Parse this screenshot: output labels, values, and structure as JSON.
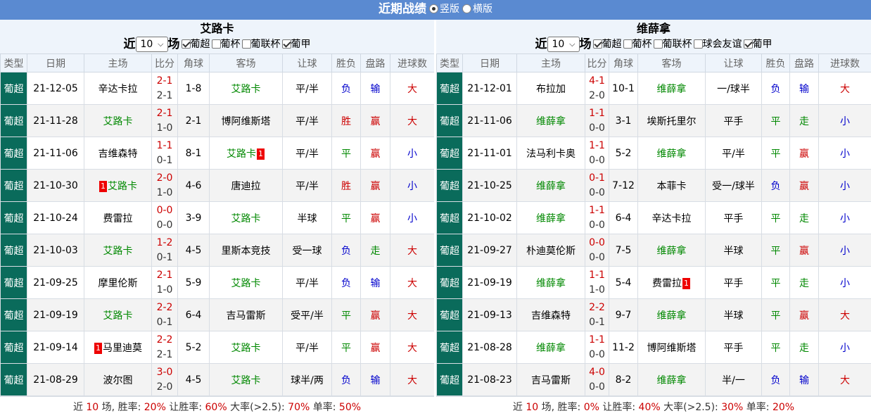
{
  "header": {
    "title": "近期战绩",
    "view_vertical": "竖版",
    "view_horizontal": "横版"
  },
  "columns": [
    "类型",
    "日期",
    "主场",
    "比分",
    "角球",
    "客场",
    "让球",
    "胜负",
    "盘路",
    "进球数"
  ],
  "left": {
    "team": "艾路卡",
    "recent_prefix": "近",
    "recent_count": "10",
    "recent_suffix": "场",
    "filters": [
      {
        "label": "葡超",
        "checked": true
      },
      {
        "label": "葡杯",
        "checked": false
      },
      {
        "label": "葡联杯",
        "checked": false
      },
      {
        "label": "葡甲",
        "checked": true
      }
    ],
    "rows": [
      {
        "type": "葡超",
        "date": "21-12-05",
        "home": "辛达卡拉",
        "home_hl": false,
        "home_rc": "",
        "ft": "2-1",
        "ht": "2-1",
        "corner": "1-8",
        "away": "艾路卡",
        "away_hl": true,
        "away_rc": "",
        "handicap": "平/半",
        "result": "负",
        "result_c": "blue",
        "pan": "输",
        "pan_c": "blue",
        "goals": "大",
        "goals_c": "red"
      },
      {
        "type": "葡超",
        "date": "21-11-28",
        "home": "艾路卡",
        "home_hl": true,
        "home_rc": "",
        "ft": "2-1",
        "ht": "1-0",
        "corner": "2-1",
        "away": "博阿维斯塔",
        "away_hl": false,
        "away_rc": "",
        "handicap": "平/半",
        "result": "胜",
        "result_c": "red",
        "pan": "赢",
        "pan_c": "red",
        "goals": "大",
        "goals_c": "red"
      },
      {
        "type": "葡超",
        "date": "21-11-06",
        "home": "吉维森特",
        "home_hl": false,
        "home_rc": "",
        "ft": "1-1",
        "ht": "0-1",
        "corner": "8-1",
        "away": "艾路卡",
        "away_hl": true,
        "away_rc": "1",
        "handicap": "平/半",
        "result": "平",
        "result_c": "green",
        "pan": "赢",
        "pan_c": "red",
        "goals": "小",
        "goals_c": "blue"
      },
      {
        "type": "葡超",
        "date": "21-10-30",
        "home": "艾路卡",
        "home_hl": true,
        "home_rc_pre": "1",
        "home_rc": "",
        "ft": "2-0",
        "ht": "1-0",
        "corner": "4-6",
        "away": "唐迪拉",
        "away_hl": false,
        "away_rc": "",
        "handicap": "平/半",
        "result": "胜",
        "result_c": "red",
        "pan": "赢",
        "pan_c": "red",
        "goals": "小",
        "goals_c": "blue"
      },
      {
        "type": "葡超",
        "date": "21-10-24",
        "home": "费雷拉",
        "home_hl": false,
        "home_rc": "",
        "ft": "0-0",
        "ht": "0-0",
        "corner": "3-9",
        "away": "艾路卡",
        "away_hl": true,
        "away_rc": "",
        "handicap": "半球",
        "result": "平",
        "result_c": "green",
        "pan": "赢",
        "pan_c": "red",
        "goals": "小",
        "goals_c": "blue"
      },
      {
        "type": "葡超",
        "date": "21-10-03",
        "home": "艾路卡",
        "home_hl": true,
        "home_rc": "",
        "ft": "1-2",
        "ht": "0-1",
        "corner": "4-5",
        "away": "里斯本竞技",
        "away_hl": false,
        "away_rc": "",
        "handicap": "受一球",
        "result": "负",
        "result_c": "blue",
        "pan": "走",
        "pan_c": "green",
        "goals": "大",
        "goals_c": "red"
      },
      {
        "type": "葡超",
        "date": "21-09-25",
        "home": "摩里伦斯",
        "home_hl": false,
        "home_rc": "",
        "ft": "2-1",
        "ht": "1-0",
        "corner": "5-9",
        "away": "艾路卡",
        "away_hl": true,
        "away_rc": "",
        "handicap": "平/半",
        "result": "负",
        "result_c": "blue",
        "pan": "输",
        "pan_c": "blue",
        "goals": "大",
        "goals_c": "red"
      },
      {
        "type": "葡超",
        "date": "21-09-19",
        "home": "艾路卡",
        "home_hl": true,
        "home_rc": "",
        "ft": "2-2",
        "ht": "0-1",
        "corner": "6-4",
        "away": "吉马雷斯",
        "away_hl": false,
        "away_rc": "",
        "handicap": "受平/半",
        "result": "平",
        "result_c": "green",
        "pan": "赢",
        "pan_c": "red",
        "goals": "大",
        "goals_c": "red"
      },
      {
        "type": "葡超",
        "date": "21-09-14",
        "home": "马里迪莫",
        "home_hl": false,
        "home_rc_pre": "1",
        "home_rc": "",
        "ft": "2-2",
        "ht": "2-1",
        "corner": "5-2",
        "away": "艾路卡",
        "away_hl": true,
        "away_rc": "",
        "handicap": "平/半",
        "result": "平",
        "result_c": "green",
        "pan": "赢",
        "pan_c": "red",
        "goals": "大",
        "goals_c": "red"
      },
      {
        "type": "葡超",
        "date": "21-08-29",
        "home": "波尔图",
        "home_hl": false,
        "home_rc": "",
        "ft": "3-0",
        "ht": "2-0",
        "corner": "4-5",
        "away": "艾路卡",
        "away_hl": true,
        "away_rc": "",
        "handicap": "球半/两",
        "result": "负",
        "result_c": "blue",
        "pan": "输",
        "pan_c": "blue",
        "goals": "大",
        "goals_c": "red"
      }
    ],
    "summary": {
      "pre": "近",
      "count": "10",
      "mid": "场, 胜率:",
      "win": "20%",
      "l1": "让胜率:",
      "hwin": "60%",
      "l2": "大率(>2.5):",
      "big": "70%",
      "l3": "单率:",
      "odd": "50%"
    }
  },
  "right": {
    "team": "维薛拿",
    "recent_prefix": "近",
    "recent_count": "10",
    "recent_suffix": "场",
    "filters": [
      {
        "label": "葡超",
        "checked": true
      },
      {
        "label": "葡杯",
        "checked": false
      },
      {
        "label": "葡联杯",
        "checked": false
      },
      {
        "label": "球会友谊",
        "checked": false
      },
      {
        "label": "葡甲",
        "checked": true
      }
    ],
    "rows": [
      {
        "type": "葡超",
        "date": "21-12-01",
        "home": "布拉加",
        "home_hl": false,
        "home_rc": "",
        "ft": "4-1",
        "ht": "2-0",
        "corner": "10-1",
        "away": "维薛拿",
        "away_hl": true,
        "away_rc": "",
        "handicap": "一/球半",
        "result": "负",
        "result_c": "blue",
        "pan": "输",
        "pan_c": "blue",
        "goals": "大",
        "goals_c": "red"
      },
      {
        "type": "葡超",
        "date": "21-11-06",
        "home": "维薛拿",
        "home_hl": true,
        "home_rc": "",
        "ft": "1-1",
        "ht": "0-0",
        "corner": "3-1",
        "away": "埃斯托里尔",
        "away_hl": false,
        "away_rc": "",
        "handicap": "平手",
        "result": "平",
        "result_c": "green",
        "pan": "走",
        "pan_c": "green",
        "goals": "小",
        "goals_c": "blue"
      },
      {
        "type": "葡超",
        "date": "21-11-01",
        "home": "法马利卡奥",
        "home_hl": false,
        "home_rc": "",
        "ft": "1-1",
        "ht": "0-0",
        "corner": "5-2",
        "away": "维薛拿",
        "away_hl": true,
        "away_rc": "",
        "handicap": "平/半",
        "result": "平",
        "result_c": "green",
        "pan": "赢",
        "pan_c": "red",
        "goals": "小",
        "goals_c": "blue"
      },
      {
        "type": "葡超",
        "date": "21-10-25",
        "home": "维薛拿",
        "home_hl": true,
        "home_rc": "",
        "ft": "0-1",
        "ht": "0-0",
        "corner": "7-12",
        "away": "本菲卡",
        "away_hl": false,
        "away_rc": "",
        "handicap": "受一/球半",
        "result": "负",
        "result_c": "blue",
        "pan": "赢",
        "pan_c": "red",
        "goals": "小",
        "goals_c": "blue"
      },
      {
        "type": "葡超",
        "date": "21-10-02",
        "home": "维薛拿",
        "home_hl": true,
        "home_rc": "",
        "ft": "1-1",
        "ht": "0-0",
        "corner": "6-4",
        "away": "辛达卡拉",
        "away_hl": false,
        "away_rc": "",
        "handicap": "平手",
        "result": "平",
        "result_c": "green",
        "pan": "走",
        "pan_c": "green",
        "goals": "小",
        "goals_c": "blue"
      },
      {
        "type": "葡超",
        "date": "21-09-27",
        "home": "朴迪莫伦斯",
        "home_hl": false,
        "home_rc": "",
        "ft": "0-0",
        "ht": "0-0",
        "corner": "7-5",
        "away": "维薛拿",
        "away_hl": true,
        "away_rc": "",
        "handicap": "半球",
        "result": "平",
        "result_c": "green",
        "pan": "赢",
        "pan_c": "red",
        "goals": "小",
        "goals_c": "blue"
      },
      {
        "type": "葡超",
        "date": "21-09-19",
        "home": "维薛拿",
        "home_hl": true,
        "home_rc": "",
        "ft": "1-1",
        "ht": "1-0",
        "corner": "5-4",
        "away": "费雷拉",
        "away_hl": false,
        "away_rc": "1",
        "handicap": "平手",
        "result": "平",
        "result_c": "green",
        "pan": "走",
        "pan_c": "green",
        "goals": "小",
        "goals_c": "blue"
      },
      {
        "type": "葡超",
        "date": "21-09-13",
        "home": "吉维森特",
        "home_hl": false,
        "home_rc": "",
        "ft": "2-2",
        "ht": "0-1",
        "corner": "9-7",
        "away": "维薛拿",
        "away_hl": true,
        "away_rc": "",
        "handicap": "半球",
        "result": "平",
        "result_c": "green",
        "pan": "赢",
        "pan_c": "red",
        "goals": "大",
        "goals_c": "red"
      },
      {
        "type": "葡超",
        "date": "21-08-28",
        "home": "维薛拿",
        "home_hl": true,
        "home_rc": "",
        "ft": "1-1",
        "ht": "0-0",
        "corner": "11-2",
        "away": "博阿维斯塔",
        "away_hl": false,
        "away_rc": "",
        "handicap": "平手",
        "result": "平",
        "result_c": "green",
        "pan": "走",
        "pan_c": "green",
        "goals": "小",
        "goals_c": "blue"
      },
      {
        "type": "葡超",
        "date": "21-08-23",
        "home": "吉马雷斯",
        "home_hl": false,
        "home_rc": "",
        "ft": "4-0",
        "ht": "0-0",
        "corner": "8-2",
        "away": "维薛拿",
        "away_hl": true,
        "away_rc": "",
        "handicap": "半/一",
        "result": "负",
        "result_c": "blue",
        "pan": "输",
        "pan_c": "blue",
        "goals": "大",
        "goals_c": "red"
      }
    ],
    "summary": {
      "pre": "近",
      "count": "10",
      "mid": "场, 胜率:",
      "win": "0%",
      "l1": "让胜率:",
      "hwin": "40%",
      "l2": "大率(>2.5):",
      "big": "30%",
      "l3": "单率:",
      "odd": "20%"
    }
  }
}
